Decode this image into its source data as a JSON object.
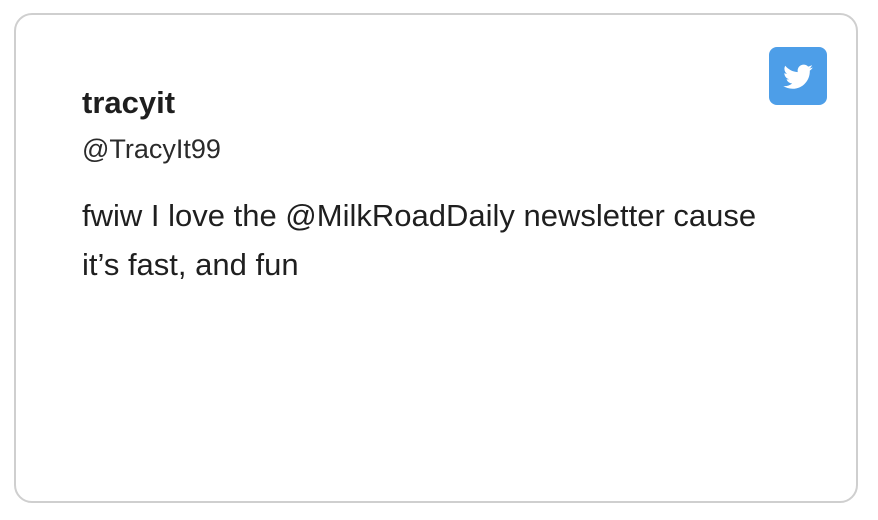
{
  "tweet": {
    "display_name": "tracyit",
    "handle": "@TracyIt99",
    "text": "fwiw I love the @MilkRoadDaily newsletter cause it’s fast, and fun"
  },
  "brand": {
    "icon": "twitter-bird-icon",
    "badge_color": "#4d9ee8",
    "icon_color": "#ffffff"
  },
  "colors": {
    "card_border": "#cfcfcf",
    "text": "#1f1f1f",
    "background": "#ffffff"
  }
}
